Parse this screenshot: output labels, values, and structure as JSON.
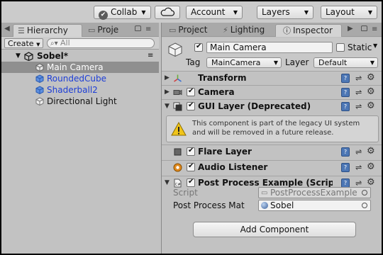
{
  "toolbar": {
    "collab": "Collab",
    "account": "Account",
    "layers": "Layers",
    "layout": "Layout"
  },
  "hierarchy": {
    "tab_label": "Hierarchy",
    "tab2_label": "Proje",
    "create_label": "Create",
    "search_placeholder": "All",
    "scene_name": "Sobel*",
    "items": [
      {
        "label": "Main Camera",
        "selected": true
      },
      {
        "label": "RoundedCube"
      },
      {
        "label": "Shaderball2"
      },
      {
        "label": "Directional Light"
      }
    ]
  },
  "inspector": {
    "tabs": [
      "Project",
      "Lighting",
      "Inspector"
    ],
    "object_name": "Main Camera",
    "static_label": "Static",
    "tag_label": "Tag",
    "tag_value": "MainCamera",
    "layer_label": "Layer",
    "layer_value": "Default",
    "components": [
      {
        "title": "Transform"
      },
      {
        "title": "Camera"
      },
      {
        "title": "GUI Layer (Deprecated)"
      },
      {
        "title": "Flare Layer"
      },
      {
        "title": "Audio Listener"
      },
      {
        "title": "Post Process Example (Script"
      }
    ],
    "warning": "This component is part of the legacy UI system and will be removed in a future release.",
    "script_label": "Script",
    "script_value": "PostProcessExample",
    "mat_label": "Post Process Mat",
    "mat_value": "Sobel",
    "add_component": "Add Component"
  },
  "colors": {
    "selection": "#8f8f8f",
    "prefab_blue": "#1d3ed6",
    "panel": "#c2c2c2"
  }
}
